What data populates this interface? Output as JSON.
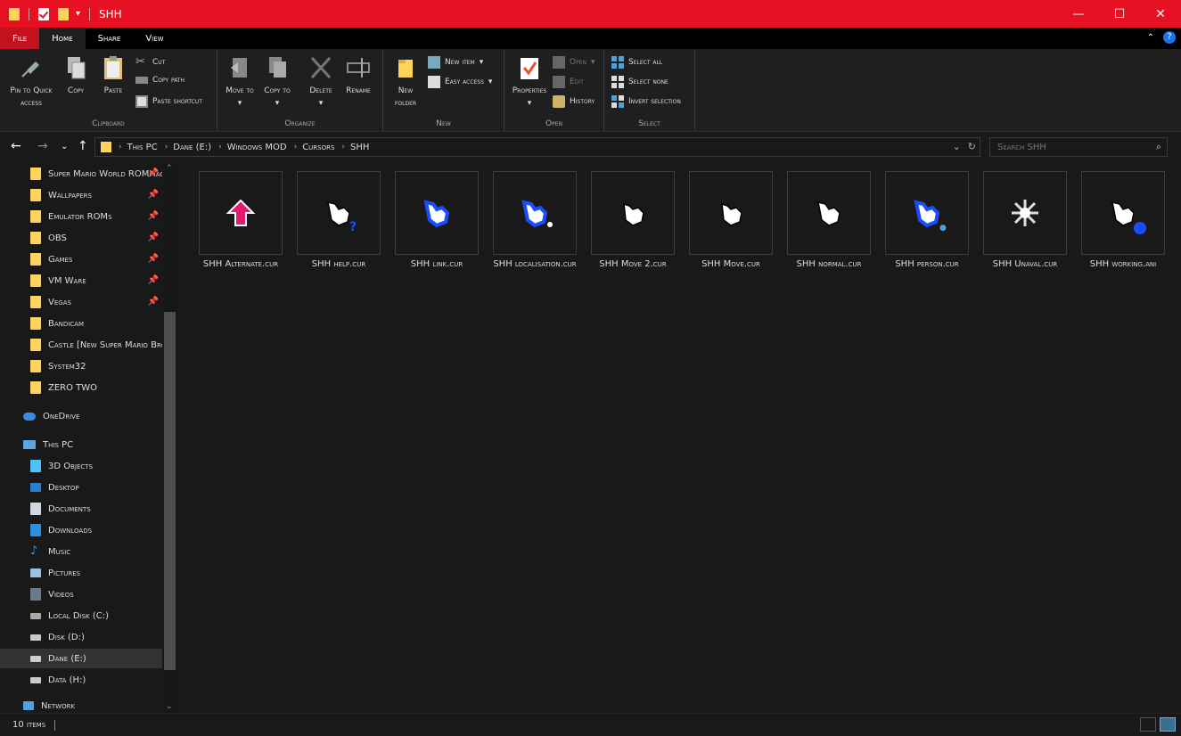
{
  "window": {
    "title": "SHH",
    "controls": [
      "minimize",
      "maximize",
      "close"
    ]
  },
  "ribbon_tabs": [
    "File",
    "Home",
    "Share",
    "View"
  ],
  "ribbon": {
    "clipboard": {
      "label": "Clipboard",
      "pin": "Pin to Quick access",
      "copy": "Copy",
      "paste": "Paste",
      "cut": "Cut",
      "copy_path": "Copy path",
      "paste_shortcut": "Paste shortcut"
    },
    "organize": {
      "label": "Organize",
      "move_to": "Move to",
      "copy_to": "Copy to",
      "delete": "Delete",
      "rename": "Rename"
    },
    "new": {
      "label": "New",
      "new_folder": "New folder",
      "new_item": "New item",
      "easy_access": "Easy access"
    },
    "open": {
      "label": "Open",
      "properties": "Properties",
      "open": "Open",
      "edit": "Edit",
      "history": "History"
    },
    "select": {
      "label": "Select",
      "select_all": "Select all",
      "select_none": "Select none",
      "invert": "Invert selection"
    }
  },
  "address": {
    "crumbs": [
      "This PC",
      "Dane (E:)",
      "Windows MOD",
      "Cursors",
      "SHH"
    ],
    "search_placeholder": "Search SHH"
  },
  "nav": {
    "quick_access": [
      {
        "label": "Super Mario World ROMHacks",
        "pinned": true
      },
      {
        "label": "Wallpapers",
        "pinned": true
      },
      {
        "label": "Emulator ROMs",
        "pinned": true
      },
      {
        "label": "OBS",
        "pinned": true
      },
      {
        "label": "Games",
        "pinned": true
      },
      {
        "label": "VM Ware",
        "pinned": true
      },
      {
        "label": "Vegas",
        "pinned": true
      },
      {
        "label": "Bandicam",
        "pinned": false
      },
      {
        "label": "Castle [New Super Mario Bros",
        "pinned": false
      },
      {
        "label": "System32",
        "pinned": false
      },
      {
        "label": "ZERO TWO",
        "pinned": false
      }
    ],
    "onedrive": "OneDrive",
    "this_pc": "This PC",
    "pc_items": [
      "3D Objects",
      "Desktop",
      "Documents",
      "Downloads",
      "Music",
      "Pictures",
      "Videos",
      "Local Disk (C:)",
      "Disk (D:)",
      "Dane (E:)",
      "Data (H:)"
    ],
    "network": "Network"
  },
  "files": [
    {
      "name": "SHH Alternate.cur",
      "kind": "arrow",
      "color": "#e6196e"
    },
    {
      "name": "SHH help.cur",
      "kind": "hand",
      "color": "#ffffff",
      "badge": "?"
    },
    {
      "name": "SHH link.cur",
      "kind": "hand",
      "color": "#1a4dff"
    },
    {
      "name": "SHH localisation.cur",
      "kind": "hand",
      "color": "#1a4dff",
      "badge": "pin"
    },
    {
      "name": "SHH Move 2.cur",
      "kind": "hand",
      "color": "#ffffff"
    },
    {
      "name": "SHH Move.cur",
      "kind": "hand",
      "color": "#ffffff"
    },
    {
      "name": "SHH normal.cur",
      "kind": "hand",
      "color": "#ffffff"
    },
    {
      "name": "SHH person.cur",
      "kind": "hand",
      "color": "#1a4dff",
      "badge": "person"
    },
    {
      "name": "SHH Unaval.cur",
      "kind": "star",
      "color": "#ffffff"
    },
    {
      "name": "SHH working.ani",
      "kind": "hand",
      "color": "#ffffff",
      "badge": "dot"
    }
  ],
  "status": {
    "count": "10 items"
  }
}
